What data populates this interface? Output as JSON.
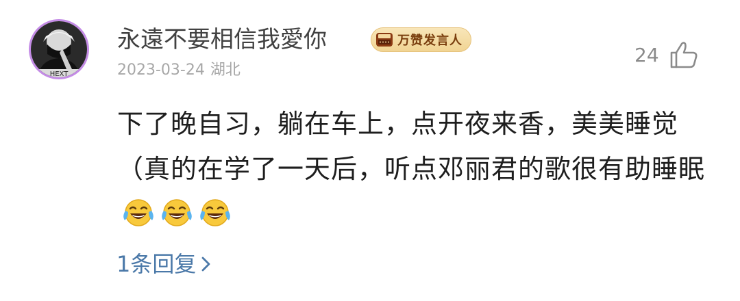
{
  "comment": {
    "user": {
      "name": "永遠不要相信我愛你",
      "avatar_caption": "HEXT",
      "avatar_ring_color": "#c48be6"
    },
    "badge": {
      "icon": "typewriter-icon",
      "label": "万赞发言人"
    },
    "date": "2023-03-24",
    "location": "湖北",
    "likes": {
      "count": "24",
      "icon": "thumbs-up-icon"
    },
    "text": "下了晚自习，躺在车上，点开夜来香，美美睡觉（真的在学了一天后，听点邓丽君的歌很有助睡眠",
    "emojis": [
      "laugh-cry-emoji",
      "laugh-cry-emoji",
      "laugh-cry-emoji"
    ],
    "replies": {
      "label": "1条回复",
      "icon": "chevron-right-icon"
    }
  },
  "colors": {
    "text_primary": "#1e1e1e",
    "username": "#414141",
    "meta": "#a7a7a7",
    "reply_link": "#4a78a8",
    "badge_bg": "#f1d493",
    "badge_text": "#7a3e0e"
  }
}
